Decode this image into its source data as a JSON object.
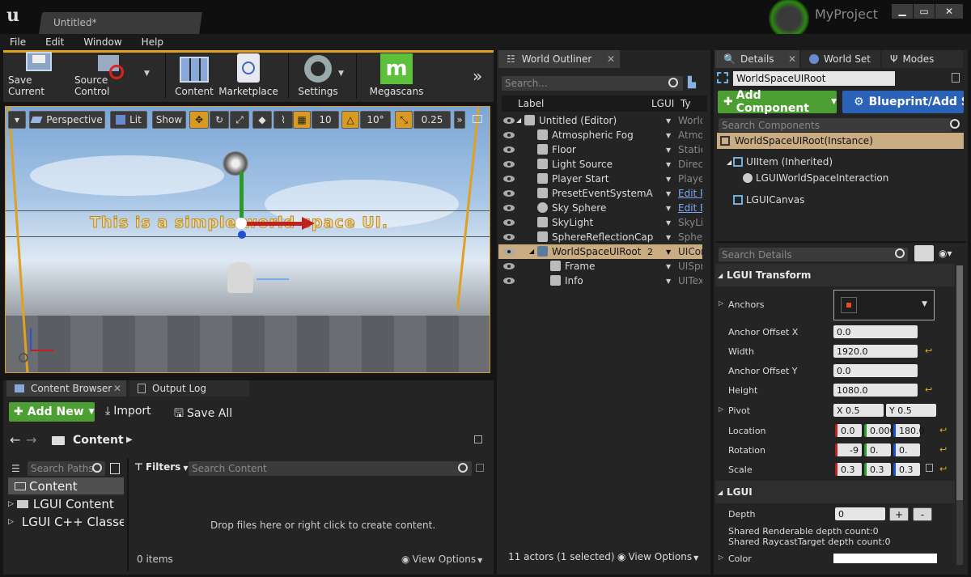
{
  "window": {
    "tab_title": "Untitled*",
    "project": "MyProject"
  },
  "menu": [
    "File",
    "Edit",
    "Window",
    "Help"
  ],
  "toolbar": {
    "save": "Save Current",
    "source": "Source Control",
    "content": "Content",
    "marketplace": "Marketplace",
    "settings": "Settings",
    "megascans": "Megascans"
  },
  "viewport": {
    "perspective": "Perspective",
    "lit": "Lit",
    "show": "Show",
    "grid": "10",
    "angle": "10°",
    "scale": "0.25",
    "ui_text": "This is a simple world space UI."
  },
  "content_browser": {
    "tab_content": "Content Browser",
    "tab_output": "Output Log",
    "add_new": "Add New",
    "import": "Import",
    "save_all": "Save All",
    "path": "Content",
    "search_paths": "Search Paths",
    "filters": "Filters",
    "search_content": "Search Content",
    "tree": [
      "Content",
      "LGUI Content",
      "LGUI C++ Classes"
    ],
    "drop_text": "Drop files here or right click to create content.",
    "items": "0 items",
    "view_options": "View Options"
  },
  "outliner": {
    "tab": "World Outliner",
    "search": "Search...",
    "col_label": "Label",
    "col_lgui": "LGUI",
    "col_type": "Ty",
    "rows": [
      {
        "label": "Untitled (Editor)",
        "type": "World"
      },
      {
        "label": "Atmospheric Fog",
        "type": "Atmos"
      },
      {
        "label": "Floor",
        "type": "Static"
      },
      {
        "label": "Light Source",
        "type": "Direct"
      },
      {
        "label": "Player Start",
        "type": "Playe"
      },
      {
        "label": "PresetEventSystemA",
        "type": "Edit P"
      },
      {
        "label": "Sky Sphere",
        "type": "Edit B"
      },
      {
        "label": "SkyLight",
        "type": "SkyLi"
      },
      {
        "label": "SphereReflectionCap",
        "type": "Spher"
      },
      {
        "label": "WorldSpaceUIRoot",
        "lgui": "2",
        "type": "UICor"
      },
      {
        "label": "Frame",
        "type": "UISpri"
      },
      {
        "label": "Info",
        "type": "UITex"
      }
    ],
    "status": "11 actors (1 selected)",
    "view_options": "View Options"
  },
  "details": {
    "tab_details": "Details",
    "tab_world": "World Set",
    "tab_modes": "Modes",
    "name": "WorldSpaceUIRoot",
    "add_component": "Add Component",
    "blueprint": "Blueprint/Add S",
    "search_components": "Search Components",
    "components": [
      "WorldSpaceUIRoot(Instance)",
      "UIItem (Inherited)",
      "LGUIWorldSpaceInteraction",
      "LGUICanvas"
    ],
    "search_details": "Search Details",
    "sec_transform": "LGUI Transform",
    "anchors": "Anchors",
    "anchor_offset_x": "Anchor Offset X",
    "anchor_offset_x_val": "0.0",
    "width": "Width",
    "width_val": "1920.0",
    "anchor_offset_y": "Anchor Offset Y",
    "anchor_offset_y_val": "0.0",
    "height": "Height",
    "height_val": "1080.0",
    "pivot": "Pivot",
    "pivot_x": "X 0.5",
    "pivot_y": "Y 0.5",
    "location": "Location",
    "loc": [
      "0.0",
      "0.000",
      "180.0"
    ],
    "rotation": "Rotation",
    "rot": [
      "-9",
      "0.",
      "0."
    ],
    "scale": "Scale",
    "scl": [
      "0.3",
      "0.3",
      "0.3"
    ],
    "sec_lgui": "LGUI",
    "depth": "Depth",
    "depth_val": "0",
    "plus": "+",
    "minus": "-",
    "shared_render": "Shared Renderable depth count:0",
    "shared_raycast": "Shared RaycastTarget depth count:0",
    "color": "Color"
  },
  "colors": {
    "accent_green": "#4c9f33",
    "accent_blue": "#2a62b8",
    "selected_row": "#c9ac82"
  }
}
